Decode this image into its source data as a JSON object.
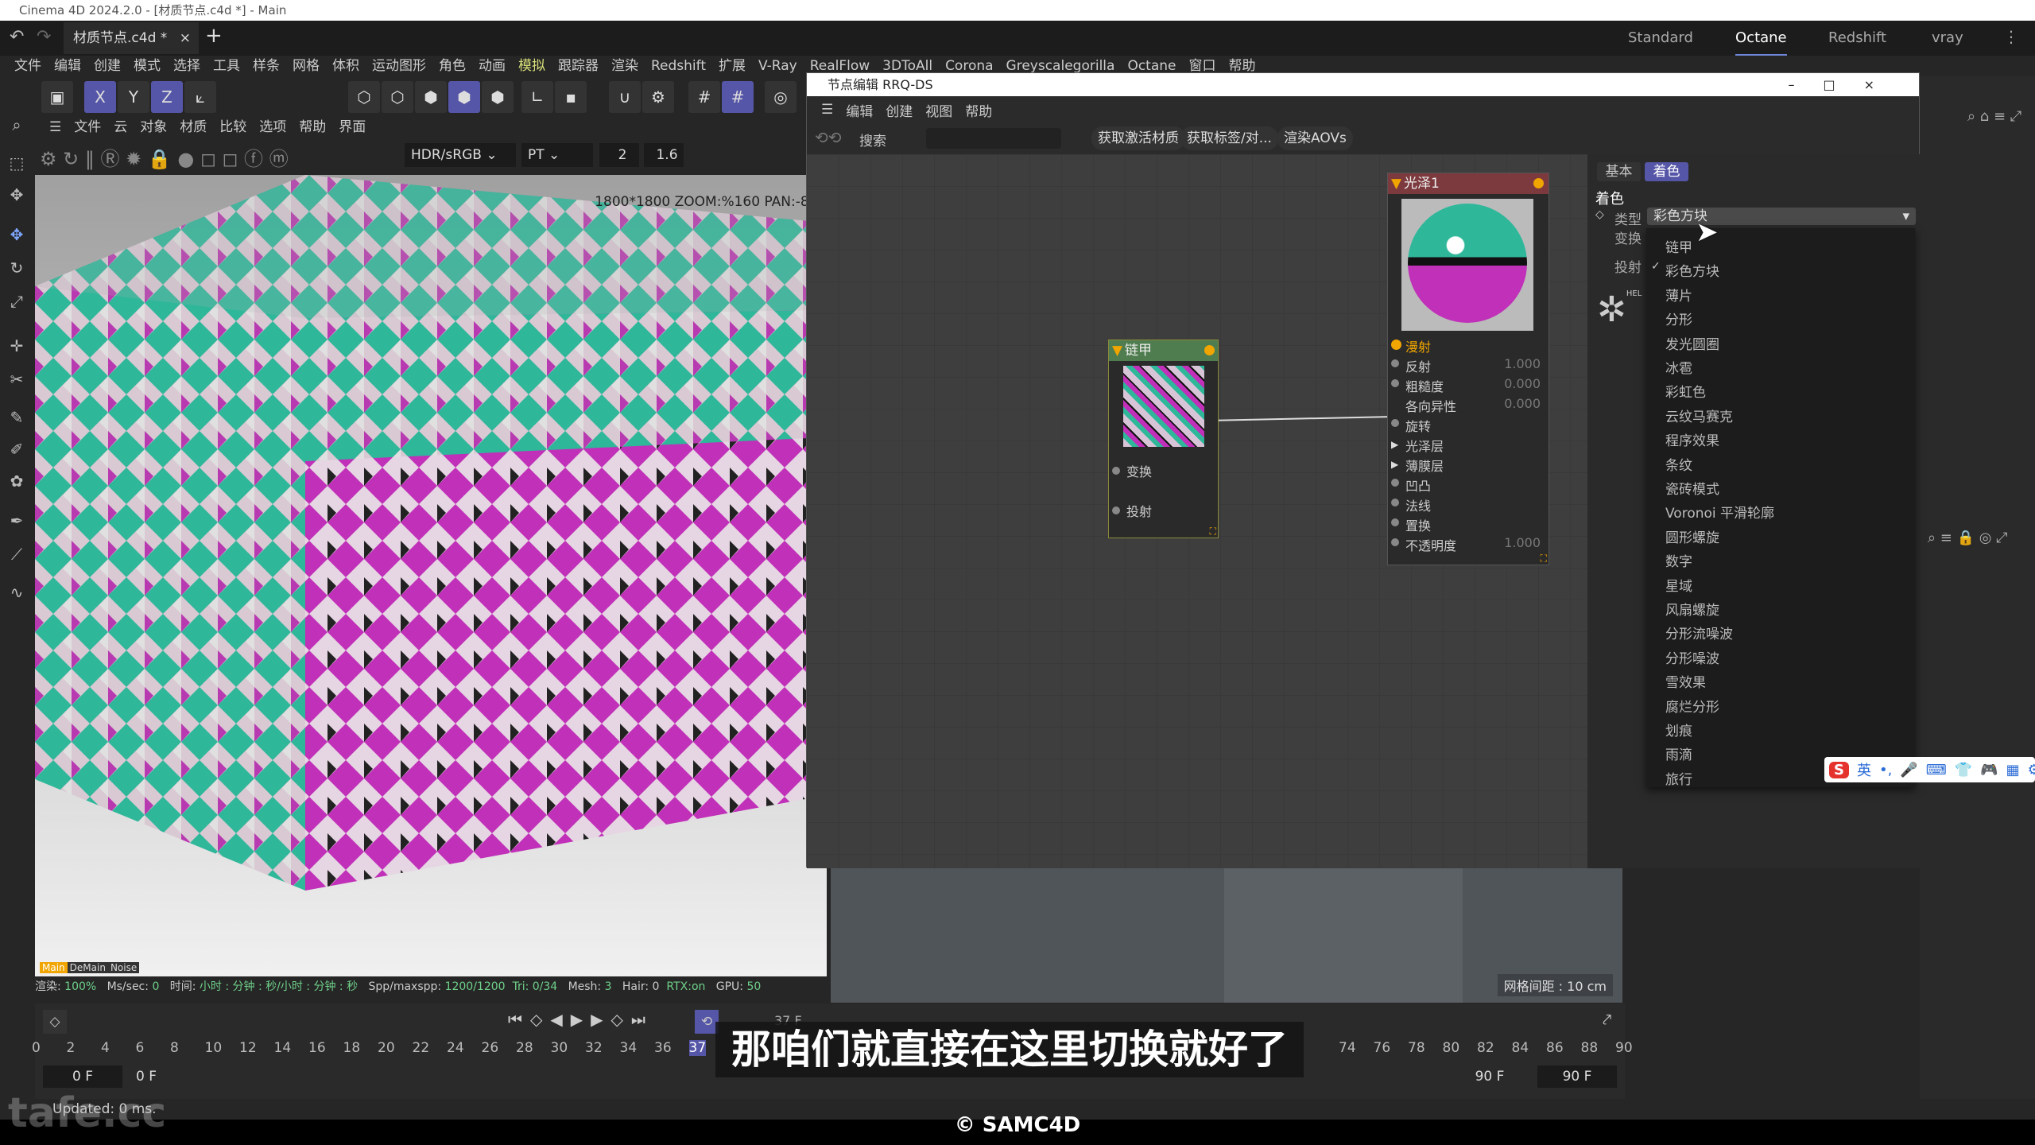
{
  "window": {
    "title": "Cinema 4D 2024.2.0 - [材质节点.c4d *] - Main",
    "file_tab": "材质节点.c4d *",
    "workspaces": [
      "Standard",
      "Octane",
      "Redshift",
      "vray"
    ],
    "active_workspace": "Octane"
  },
  "menu": [
    "文件",
    "编辑",
    "创建",
    "模式",
    "选择",
    "工具",
    "样条",
    "网格",
    "体积",
    "运动图形",
    "角色",
    "动画",
    "模拟",
    "跟踪器",
    "渲染",
    "Redshift",
    "扩展",
    "V-Ray",
    "RealFlow",
    "3DToAll",
    "Corona",
    "Greyscalegorilla",
    "Octane",
    "窗口",
    "帮助"
  ],
  "toolbar": {
    "axis": [
      "X",
      "Y",
      "Z"
    ]
  },
  "viewport": {
    "menu": [
      "文件",
      "云",
      "对象",
      "材质",
      "比较",
      "选项",
      "帮助",
      "界面"
    ],
    "color_mode": "HDR/sRGB",
    "kernel": "PT",
    "value1": "2",
    "value2": "1.6",
    "overlay": "1800*1800 ZOOM:%160 PAN:-81,-",
    "passes": [
      "Main",
      "DeMain",
      "Noise"
    ],
    "status": {
      "render_label": "渲染:",
      "render": "100%",
      "ms_label": "Ms/sec:",
      "ms": "0",
      "time_label": "时间:",
      "time": "小时 : 分钟 : 秒/小时 : 分钟 : 秒",
      "spp_label": "Spp/maxspp:",
      "spp": "1200/1200",
      "tri": "Tri: 0/34",
      "mesh_label": "Mesh:",
      "mesh": "3",
      "hair": "Hair: 0",
      "rtx": "RTX:on",
      "gpu_label": "GPU:",
      "gpu": "50"
    }
  },
  "timeline": {
    "ticks": [
      "0",
      "2",
      "4",
      "6",
      "8",
      "10",
      "12",
      "14",
      "16",
      "18",
      "20",
      "22",
      "24",
      "26",
      "28",
      "30",
      "32",
      "34",
      "36",
      "37",
      "74",
      "76",
      "78",
      "80",
      "82",
      "84",
      "86",
      "88",
      "90"
    ],
    "current": "37 F",
    "start": "0 F",
    "start2": "0 F",
    "end": "90 F",
    "end2": "90 F"
  },
  "status_bar": "Updated: 0 ms.",
  "node_editor": {
    "title": "节点编辑 RRQ-DS",
    "menu": [
      "编辑",
      "创建",
      "视图",
      "帮助"
    ],
    "search_label": "搜索",
    "buttons": [
      "获取激活材质",
      "获取标签/对...",
      "渲染AOVs"
    ],
    "nodes": {
      "chainmail": {
        "title": "链甲",
        "inputs": [
          "变换",
          "投射"
        ],
        "color": "#4f7d4f"
      },
      "glossy": {
        "title": "光泽1",
        "color": "#7d3a3e",
        "inputs": [
          {
            "label": "漫射",
            "value": ""
          },
          {
            "label": "反射",
            "value": "1.000"
          },
          {
            "label": "粗糙度",
            "value": "0.000"
          },
          {
            "label": "各向异性",
            "value": "0.000"
          },
          {
            "label": "旋转",
            "value": ""
          },
          {
            "label": "光泽层",
            "value": ""
          },
          {
            "label": "薄膜层",
            "value": ""
          },
          {
            "label": "凹凸",
            "value": ""
          },
          {
            "label": "法线",
            "value": ""
          },
          {
            "label": "置换",
            "value": ""
          },
          {
            "label": "不透明度",
            "value": "1.000"
          }
        ]
      }
    },
    "attributes": {
      "tabs": [
        "基本",
        "着色"
      ],
      "active_tab": "着色",
      "section": "着色",
      "type_label": "类型",
      "type_value": "彩色方块",
      "rows": [
        "变换",
        "投射"
      ],
      "logo_text": "HEL"
    },
    "dropdown": {
      "selected": "彩色方块",
      "items": [
        "链甲",
        "彩色方块",
        "薄片",
        "分形",
        "发光圆圈",
        "冰雹",
        "彩虹色",
        "云纹马赛克",
        "程序效果",
        "条纹",
        "瓷砖模式",
        "Voronoi 平滑轮廓",
        "圆形螺旋",
        "数字",
        "星域",
        "风扇螺旋",
        "分形流噪波",
        "分形噪波",
        "雪效果",
        "腐烂分形",
        "划痕",
        "雨滴",
        "旅行"
      ]
    }
  },
  "lower_viewport": {
    "grid": "网格间距 : 10 cm"
  },
  "ime": {
    "label": "英"
  },
  "subtitle": "那咱们就直接在这里切换就好了",
  "watermark": "tafe.cc",
  "copyright": "© SAMC4D",
  "colors": {
    "accent": "#5656a8",
    "port": "#f0a500",
    "status_green": "#6fd18a"
  }
}
